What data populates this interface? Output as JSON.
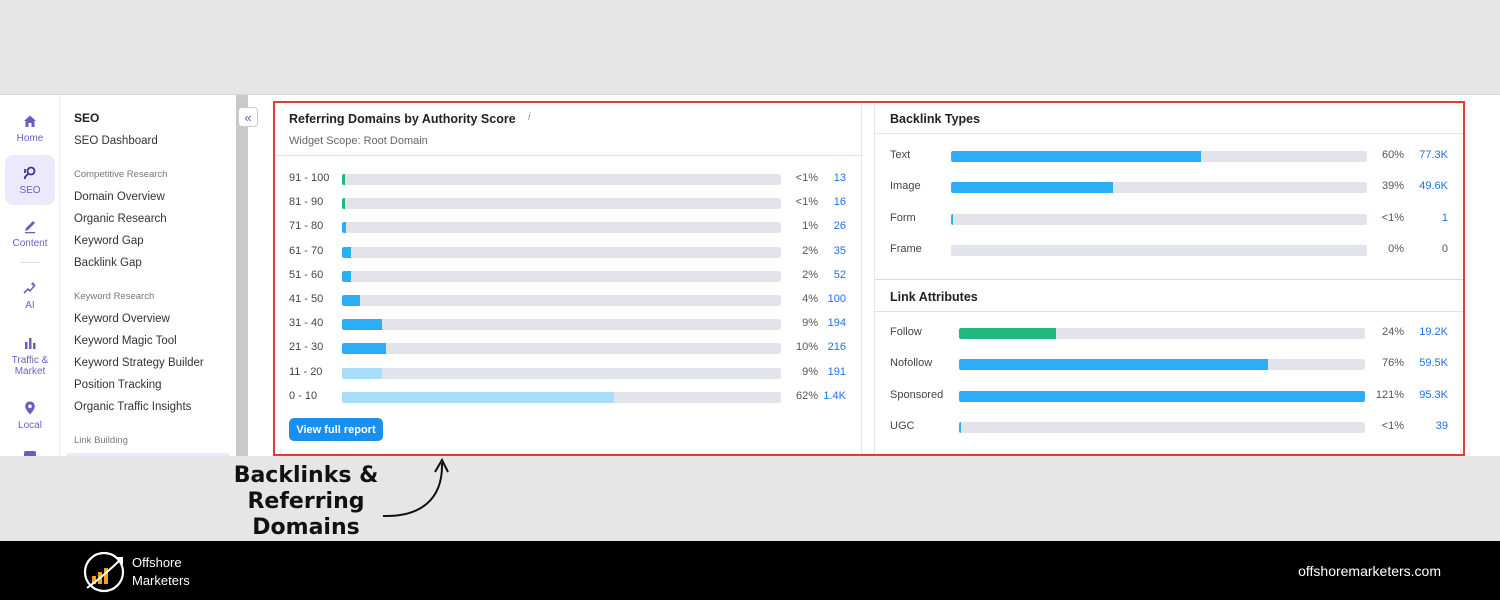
{
  "rail": {
    "items": [
      {
        "label": "Home",
        "icon": "home-icon"
      },
      {
        "label": "SEO",
        "icon": "seo-icon",
        "active": true
      },
      {
        "label": "Content",
        "icon": "pen-icon"
      },
      {
        "label": "AI",
        "icon": "sparkle-icon"
      },
      {
        "label_line1": "Traffic &",
        "label_line2": "Market",
        "icon": "bar-chart-icon"
      },
      {
        "label": "Local",
        "icon": "location-pin-icon"
      }
    ]
  },
  "menu": {
    "title": "SEO",
    "dashboard": "SEO Dashboard",
    "sections": [
      {
        "heading": "Competitive Research",
        "links": [
          "Domain Overview",
          "Organic Research",
          "Keyword Gap",
          "Backlink Gap"
        ]
      },
      {
        "heading": "Keyword Research",
        "links": [
          "Keyword Overview",
          "Keyword Magic Tool",
          "Keyword Strategy Builder",
          "Position Tracking",
          "Organic Traffic Insights"
        ]
      },
      {
        "heading": "Link Building",
        "links": []
      }
    ],
    "collapse_glyph": "«"
  },
  "referring_domains": {
    "title": "Referring Domains by Authority Score",
    "info_glyph": "i",
    "scope": "Widget Scope: Root Domain",
    "button": "View full report",
    "rows": [
      {
        "range": "91 - 100",
        "pct": "<1%",
        "count": "13",
        "fill": 0.5,
        "color": "#1fb87e"
      },
      {
        "range": "81 - 90",
        "pct": "<1%",
        "count": "16",
        "fill": 0.6,
        "color": "#1fb87e"
      },
      {
        "range": "71 - 80",
        "pct": "1%",
        "count": "26",
        "fill": 1,
        "color": "#2aaef5"
      },
      {
        "range": "61 - 70",
        "pct": "2%",
        "count": "35",
        "fill": 2,
        "color": "#2aaef5"
      },
      {
        "range": "51 - 60",
        "pct": "2%",
        "count": "52",
        "fill": 2,
        "color": "#2aaef5"
      },
      {
        "range": "41 - 50",
        "pct": "4%",
        "count": "100",
        "fill": 4,
        "color": "#2aaef5"
      },
      {
        "range": "31 - 40",
        "pct": "9%",
        "count": "194",
        "fill": 9,
        "color": "#2aaef5"
      },
      {
        "range": "21 - 30",
        "pct": "10%",
        "count": "216",
        "fill": 10,
        "color": "#2aaef5"
      },
      {
        "range": "11 - 20",
        "pct": "9%",
        "count": "191",
        "fill": 9,
        "color": "#a8dcfb"
      },
      {
        "range": "0 - 10",
        "pct": "62%",
        "count": "1.4K",
        "fill": 62,
        "color": "#a8dcfb"
      }
    ]
  },
  "backlink_types": {
    "title": "Backlink Types",
    "rows": [
      {
        "label": "Text",
        "pct": "60%",
        "count": "77.3K",
        "fill": 60,
        "color": "#2aaef5"
      },
      {
        "label": "Image",
        "pct": "39%",
        "count": "49.6K",
        "fill": 39,
        "color": "#2aaef5"
      },
      {
        "label": "Form",
        "pct": "<1%",
        "count": "1",
        "fill": 0.3,
        "color": "#2aaef5"
      },
      {
        "label": "Frame",
        "pct": "0%",
        "count": "0",
        "fill": 0,
        "color": "#2aaef5"
      }
    ]
  },
  "link_attributes": {
    "title": "Link Attributes",
    "rows": [
      {
        "label": "Follow",
        "pct": "24%",
        "count": "19.2K",
        "fill": 24,
        "color": "#1fb87e"
      },
      {
        "label": "Nofollow",
        "pct": "76%",
        "count": "59.5K",
        "fill": 76,
        "color": "#2aaef5"
      },
      {
        "label": "Sponsored",
        "pct": "121%",
        "count": "95.3K",
        "fill": 100,
        "color": "#2aaef5"
      },
      {
        "label": "UGC",
        "pct": "<1%",
        "count": "39",
        "fill": 0.3,
        "color": "#2aaef5"
      }
    ]
  },
  "annotation": {
    "line1": "Backlinks &",
    "line2": "Referring",
    "line3": "Domains"
  },
  "footer": {
    "brand_line1": "Offshore",
    "brand_line2": "Marketers",
    "site": "offshoremarketers.com"
  },
  "colors": {
    "highlight": "#e03a3a",
    "accent_purple": "#6a5fc1",
    "link_blue": "#1a73e8",
    "bar_blue": "#2aaef5",
    "bar_green": "#1fb87e",
    "bar_light": "#a8dcfb"
  }
}
